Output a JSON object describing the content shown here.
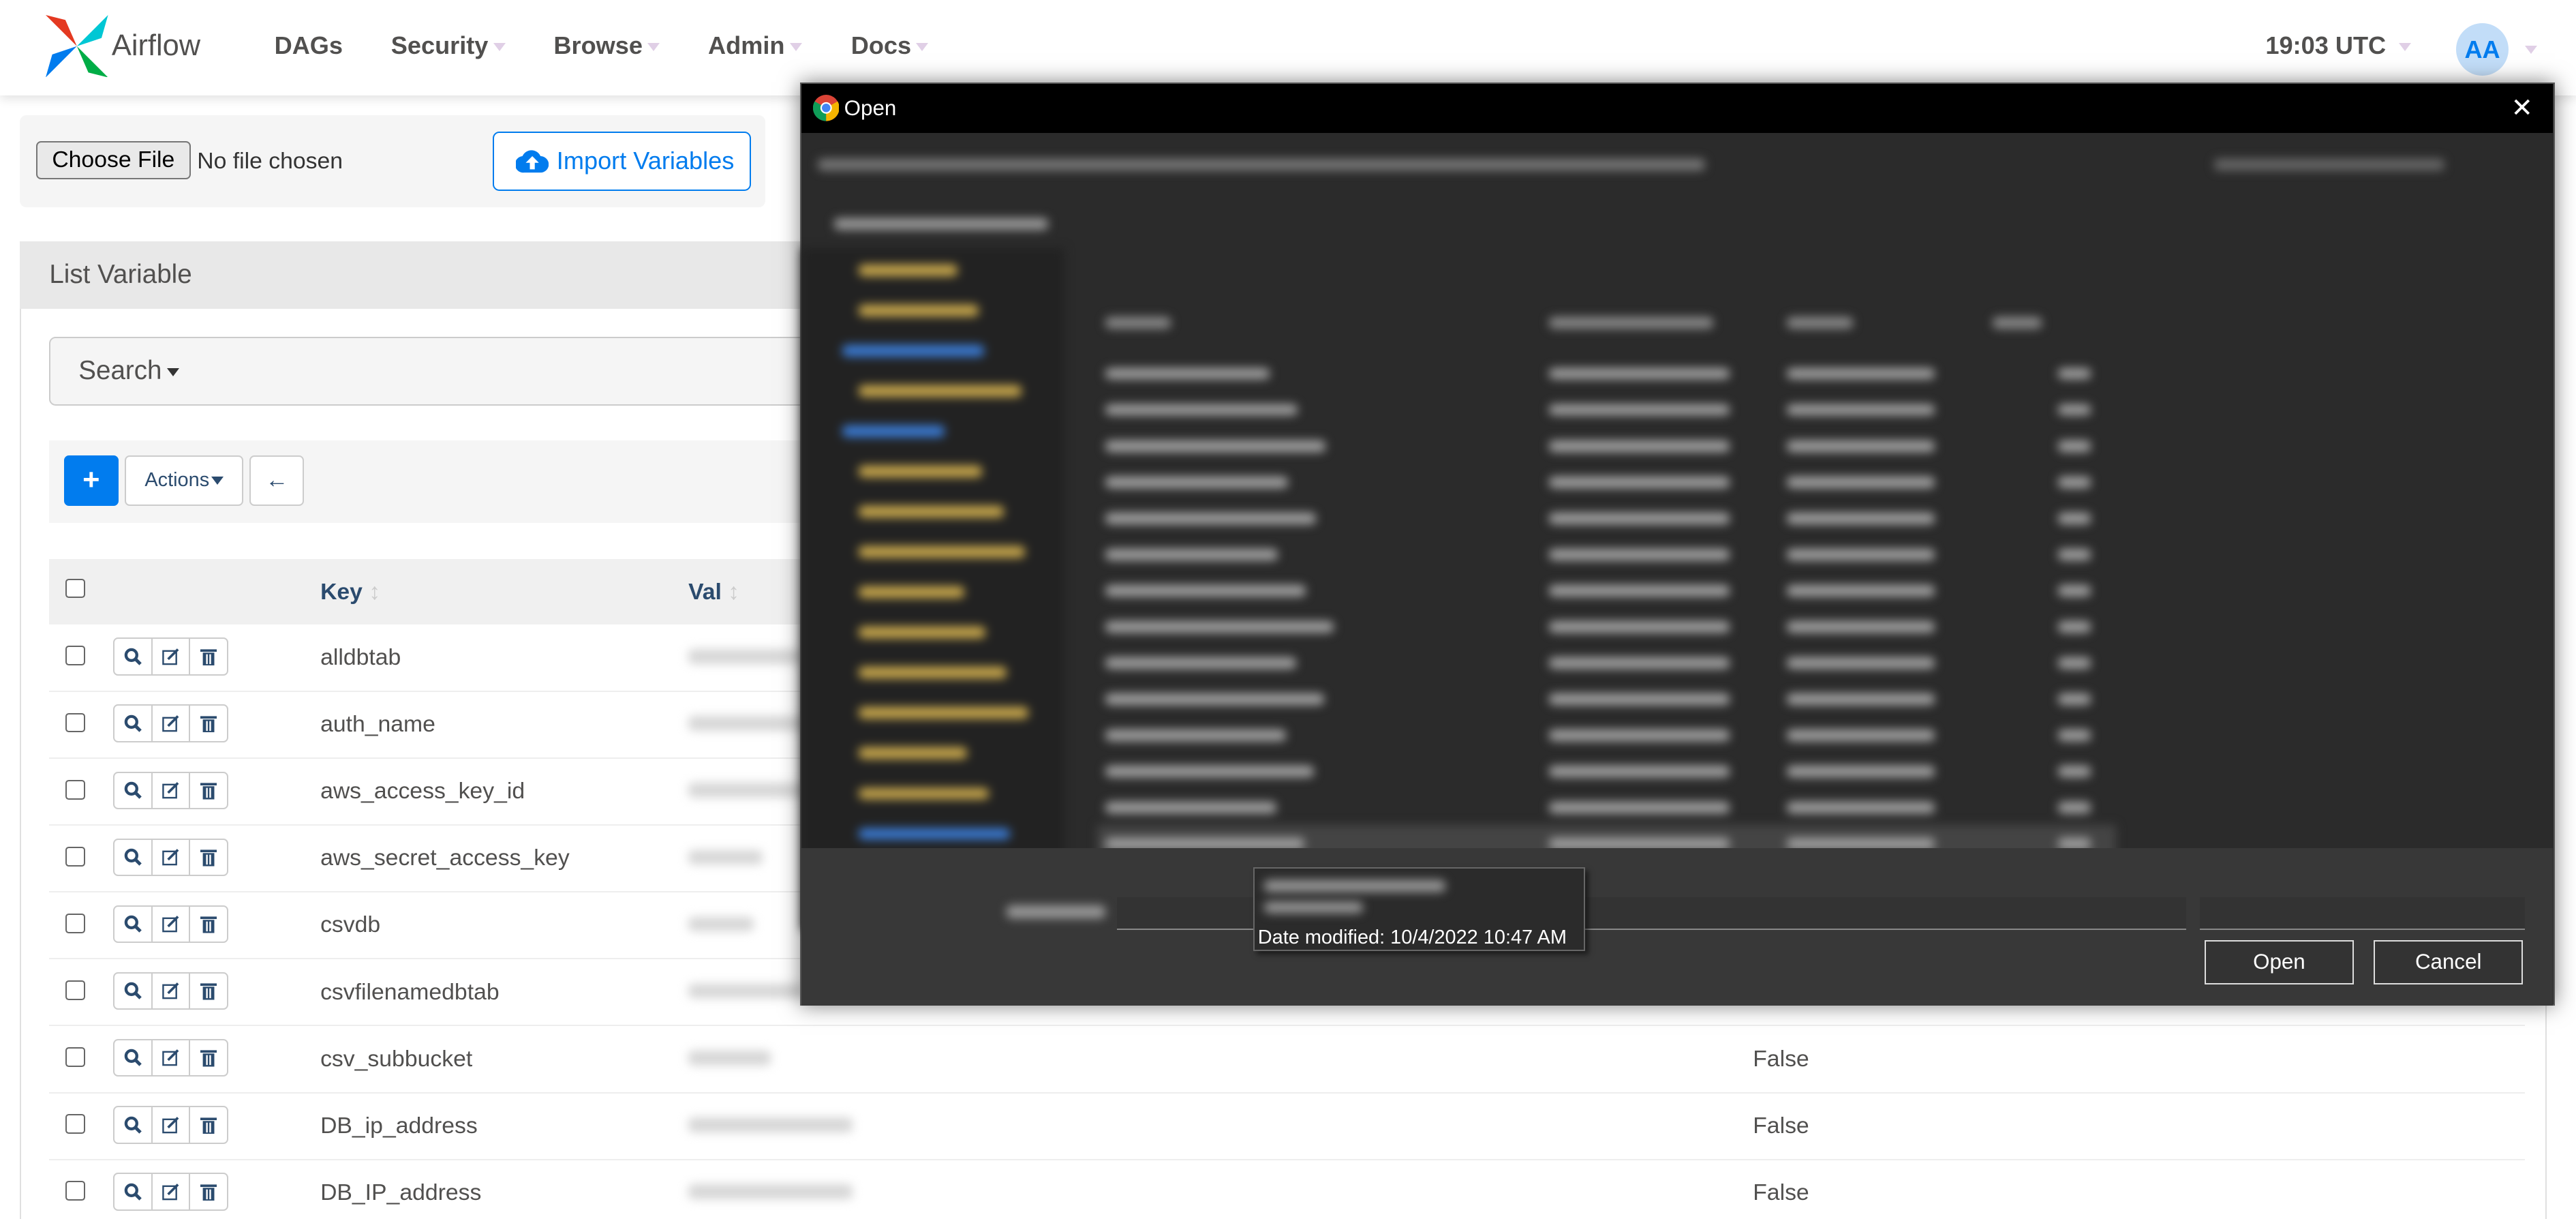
{
  "navbar": {
    "brand": "Airflow",
    "items": [
      {
        "label": "DAGs",
        "dropdown": false
      },
      {
        "label": "Security",
        "dropdown": true
      },
      {
        "label": "Browse",
        "dropdown": true
      },
      {
        "label": "Admin",
        "dropdown": true
      },
      {
        "label": "Docs",
        "dropdown": true
      }
    ],
    "time": "19:03 UTC",
    "avatar": "AA"
  },
  "import": {
    "choose_file": "Choose File",
    "no_file": "No file chosen",
    "import_button": "Import Variables"
  },
  "list": {
    "title": "List Variable",
    "search": "Search",
    "add": "+",
    "actions": "Actions",
    "back": "←"
  },
  "table": {
    "headers": {
      "key": "Key",
      "val": "Val"
    },
    "rows": [
      {
        "key": "alldbtab",
        "encrypted": ""
      },
      {
        "key": "auth_name",
        "encrypted": ""
      },
      {
        "key": "aws_access_key_id",
        "encrypted": ""
      },
      {
        "key": "aws_secret_access_key",
        "encrypted": ""
      },
      {
        "key": "csvdb",
        "encrypted": ""
      },
      {
        "key": "csvfilenamedbtab",
        "encrypted": ""
      },
      {
        "key": "csv_subbucket",
        "encrypted": "False"
      },
      {
        "key": "DB_ip_address",
        "encrypted": "False"
      },
      {
        "key": "DB_IP_address",
        "encrypted": "False"
      }
    ]
  },
  "dialog": {
    "title": "Open",
    "tooltip": "Date modified: 10/4/2022 10:47 AM",
    "open": "Open",
    "cancel": "Cancel"
  },
  "colors": {
    "accent": "#017cee",
    "avatar_bg": "#c2ddf8",
    "icon": "#2b4b6e"
  }
}
